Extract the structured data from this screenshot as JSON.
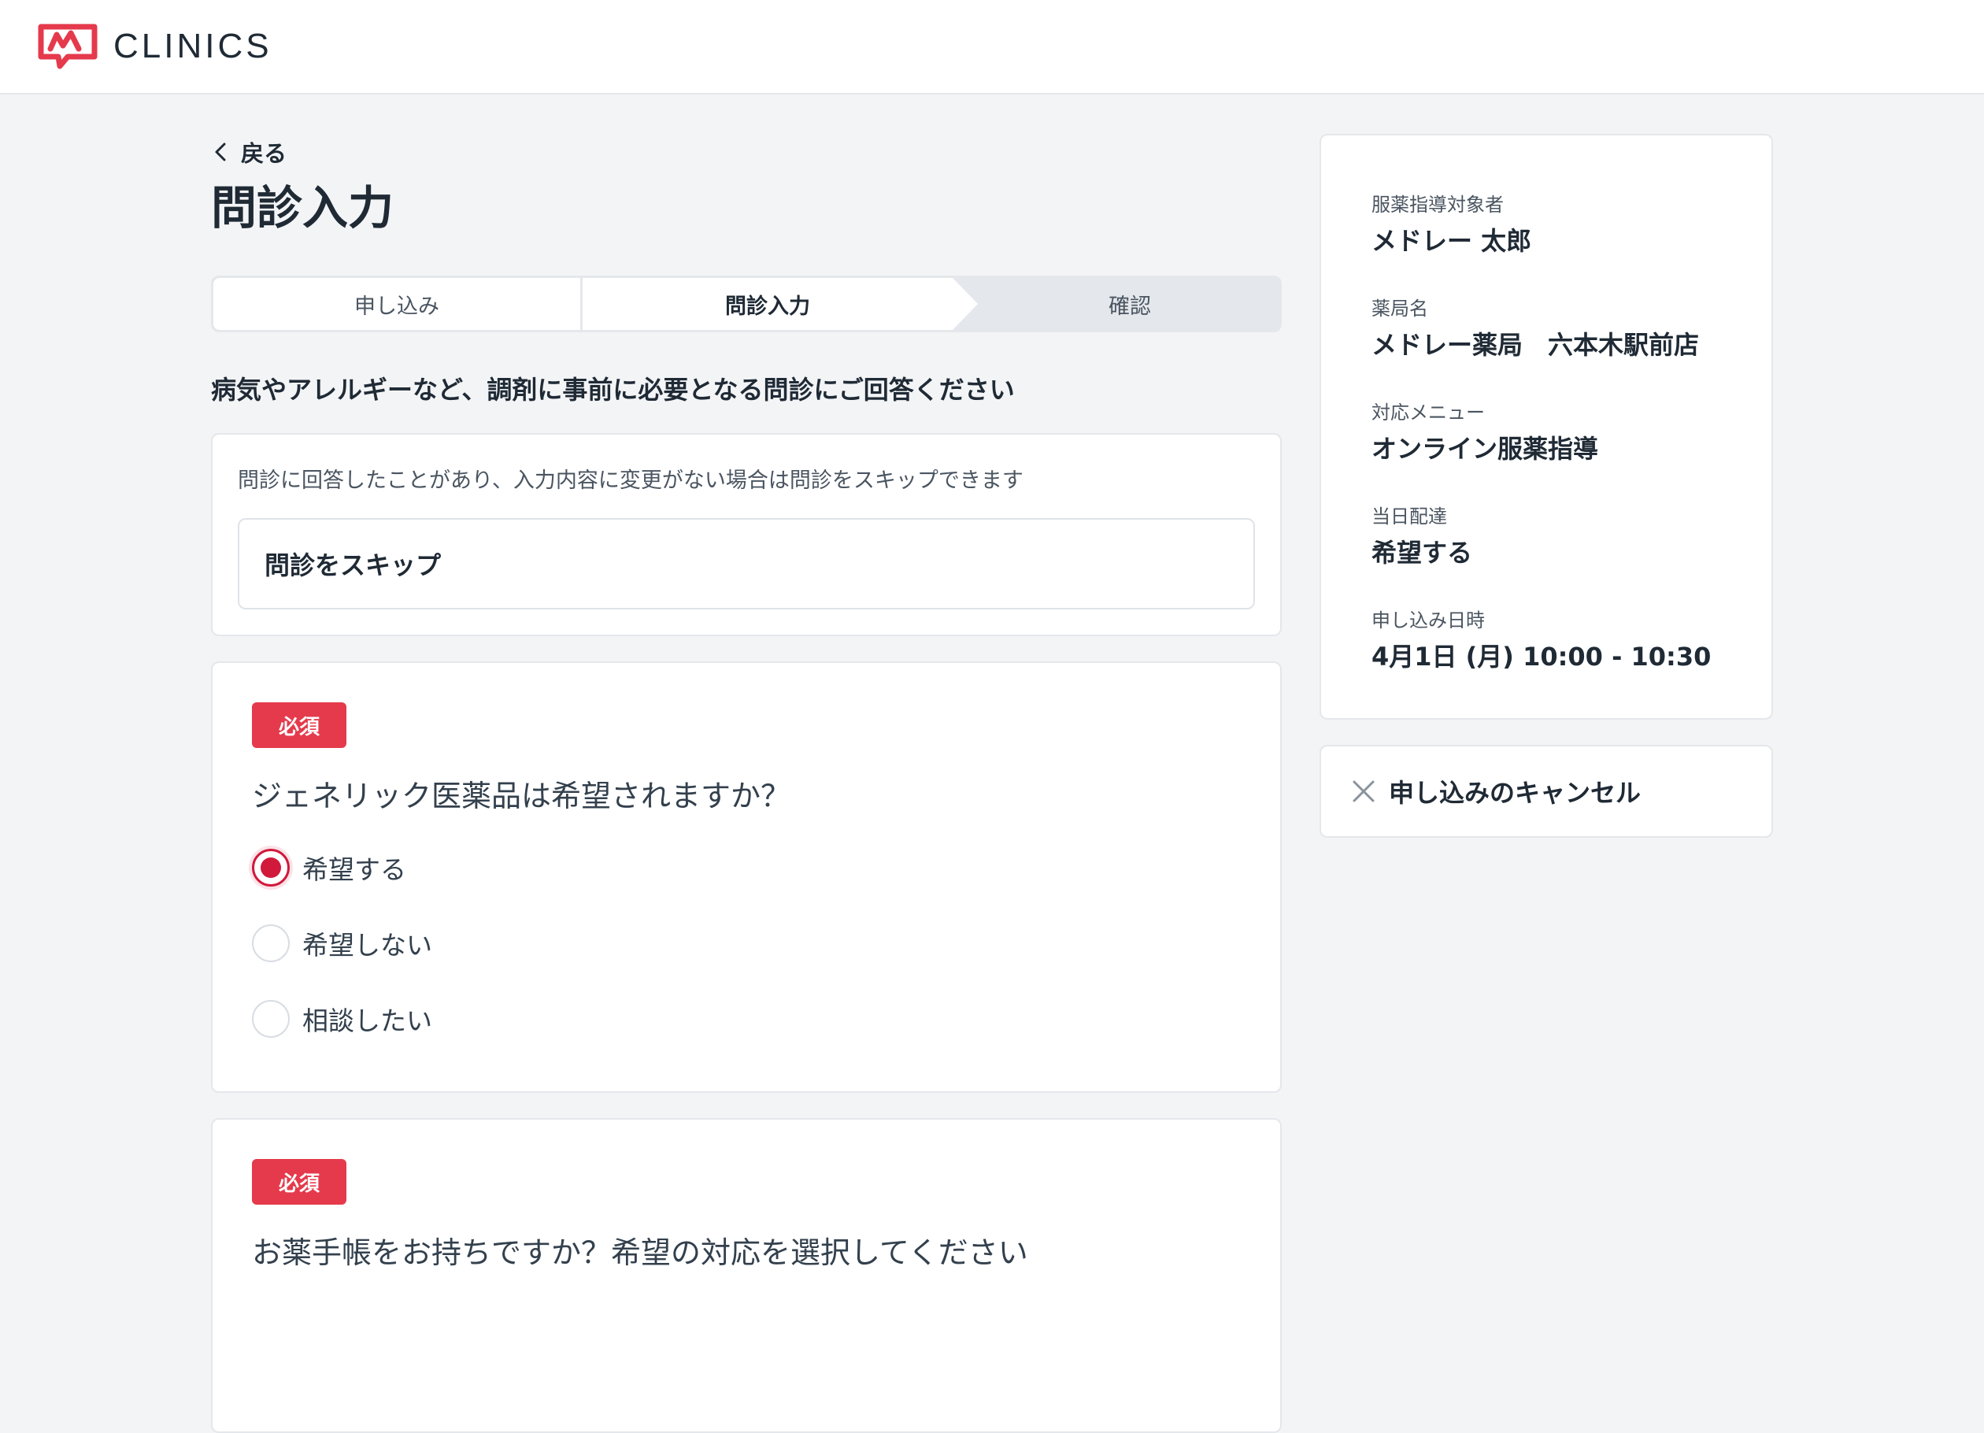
{
  "header": {
    "logo_text": "CLINICS"
  },
  "nav": {
    "back_label": "戻る"
  },
  "page_title": "問診入力",
  "stepper": {
    "steps": [
      {
        "label": "申し込み"
      },
      {
        "label": "問診入力"
      },
      {
        "label": "確認"
      }
    ],
    "current": 1
  },
  "section_heading": "病気やアレルギーなど、調剤に事前に必要となる問診にご回答ください",
  "skip": {
    "description": "問診に回答したことがあり、入力内容に変更がない場合は問診をスキップできます",
    "button_label": "問診をスキップ"
  },
  "questions": [
    {
      "badge": "必須",
      "text": "ジェネリック医薬品は希望されますか？",
      "options": [
        {
          "label": "希望する",
          "checked": true
        },
        {
          "label": "希望しない",
          "checked": false
        },
        {
          "label": "相談したい",
          "checked": false
        }
      ]
    },
    {
      "badge": "必須",
      "text": "お薬手帳をお持ちですか？希望の対応を選択してください"
    }
  ],
  "sidebar": {
    "items": [
      {
        "label": "服薬指導対象者",
        "value": "メドレー 太郎"
      },
      {
        "label": "薬局名",
        "value": "メドレー薬局　六本木駅前店"
      },
      {
        "label": "対応メニュー",
        "value": "オンライン服薬指導"
      },
      {
        "label": "当日配達",
        "value": "希望する"
      },
      {
        "label": "申し込み日時",
        "value": "4月1日 (月) 10:00 - 10:30"
      }
    ],
    "cancel_label": "申し込みのキャンセル"
  },
  "colors": {
    "accent": "#d1193c",
    "badge": "#e53a4c",
    "logo": "#e53a4c"
  }
}
